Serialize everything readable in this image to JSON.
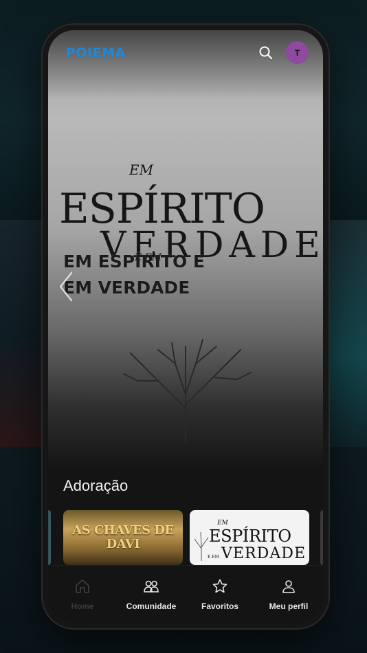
{
  "app": {
    "logo": "POIEMA"
  },
  "header": {
    "search_icon": "search-icon",
    "avatar_initial": "T"
  },
  "hero": {
    "art_word_top": "EM",
    "art_word_main": "ESPÍRITO",
    "art_word_low": "E EM",
    "art_word_bottom": "VERDADE",
    "title_line1": "EM ESPÍRITO E",
    "title_line2": "EM VERDADE"
  },
  "section": {
    "title": "Adoração",
    "cards": [
      {
        "title_line1": "AS CHAVES DE",
        "title_line2": "DAVI"
      },
      {
        "title_top": "EM",
        "title_main": "ESPÍRITO",
        "title_low": "E EM",
        "title_bottom": "VERDADE"
      }
    ]
  },
  "nav": {
    "items": [
      {
        "label": "Home",
        "icon": "home-icon",
        "active": true
      },
      {
        "label": "Comunidade",
        "icon": "community-icon",
        "active": false
      },
      {
        "label": "Favoritos",
        "icon": "star-icon",
        "active": false
      },
      {
        "label": "Meu perfil",
        "icon": "user-icon",
        "active": false
      }
    ]
  },
  "colors": {
    "brand": "#1e88d8",
    "avatar": "#8e4a9c",
    "background": "#141414"
  }
}
